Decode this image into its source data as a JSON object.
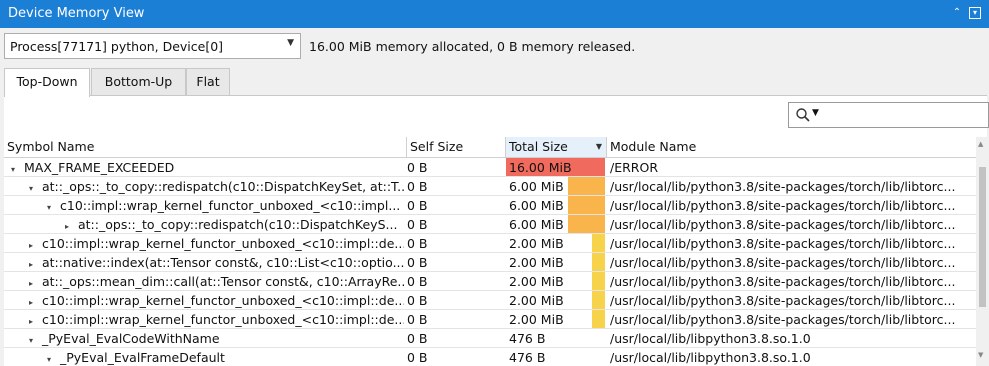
{
  "window": {
    "title": "Device Memory View"
  },
  "process_select": {
    "value": "Process[77171] python, Device[0]"
  },
  "summary": "16.00 MiB memory allocated, 0 B memory released.",
  "tabs": [
    {
      "label": "Top-Down",
      "active": true
    },
    {
      "label": "Bottom-Up",
      "active": false
    },
    {
      "label": "Flat",
      "active": false
    }
  ],
  "search": {
    "placeholder": ""
  },
  "columns": {
    "symbol": "Symbol Name",
    "self": "Self Size",
    "total": "Total Size",
    "module": "Module Name"
  },
  "rows": [
    {
      "symbol": "MAX_FRAME_EXCEEDED",
      "self": "0 B",
      "total": "16.00 MiB",
      "total_fraction": 1.0,
      "bar_color": "#f06a5e",
      "module": "/ERROR",
      "depth": 0,
      "expander": "expanded"
    },
    {
      "symbol": "at::_ops::_to_copy::redispatch(c10::DispatchKeySet, at::T...",
      "self": "0 B",
      "total": "6.00 MiB",
      "total_fraction": 0.375,
      "bar_color": "#f9b44c",
      "module": "/usr/local/lib/python3.8/site-packages/torch/lib/libtorc...",
      "depth": 1,
      "expander": "expanded"
    },
    {
      "symbol": "c10::impl::wrap_kernel_functor_unboxed_<c10::impl...",
      "self": "0 B",
      "total": "6.00 MiB",
      "total_fraction": 0.375,
      "bar_color": "#f9b44c",
      "module": "/usr/local/lib/python3.8/site-packages/torch/lib/libtorc...",
      "depth": 2,
      "expander": "expanded"
    },
    {
      "symbol": "at::_ops::_to_copy::redispatch(c10::DispatchKeyS...",
      "self": "0 B",
      "total": "6.00 MiB",
      "total_fraction": 0.375,
      "bar_color": "#f9b44c",
      "module": "/usr/local/lib/python3.8/site-packages/torch/lib/libtorc...",
      "depth": 3,
      "expander": "collapsed"
    },
    {
      "symbol": "c10::impl::wrap_kernel_functor_unboxed_<c10::impl::de...",
      "self": "0 B",
      "total": "2.00 MiB",
      "total_fraction": 0.125,
      "bar_color": "#f6d34a",
      "module": "/usr/local/lib/python3.8/site-packages/torch/lib/libtorc...",
      "depth": 1,
      "expander": "collapsed"
    },
    {
      "symbol": "at::native::index(at::Tensor const&, c10::List<c10::optio...",
      "self": "0 B",
      "total": "2.00 MiB",
      "total_fraction": 0.125,
      "bar_color": "#f6d34a",
      "module": "/usr/local/lib/python3.8/site-packages/torch/lib/libtorc...",
      "depth": 1,
      "expander": "collapsed"
    },
    {
      "symbol": "at::_ops::mean_dim::call(at::Tensor const&, c10::ArrayRe...",
      "self": "0 B",
      "total": "2.00 MiB",
      "total_fraction": 0.125,
      "bar_color": "#f6d34a",
      "module": "/usr/local/lib/python3.8/site-packages/torch/lib/libtorc...",
      "depth": 1,
      "expander": "collapsed"
    },
    {
      "symbol": "c10::impl::wrap_kernel_functor_unboxed_<c10::impl::de...",
      "self": "0 B",
      "total": "2.00 MiB",
      "total_fraction": 0.125,
      "bar_color": "#f6d34a",
      "module": "/usr/local/lib/python3.8/site-packages/torch/lib/libtorc...",
      "depth": 1,
      "expander": "collapsed"
    },
    {
      "symbol": "c10::impl::wrap_kernel_functor_unboxed_<c10::impl::de...",
      "self": "0 B",
      "total": "2.00 MiB",
      "total_fraction": 0.125,
      "bar_color": "#f6d34a",
      "module": "/usr/local/lib/python3.8/site-packages/torch/lib/libtorc...",
      "depth": 1,
      "expander": "collapsed"
    },
    {
      "symbol": "_PyEval_EvalCodeWithName",
      "self": "0 B",
      "total": "476 B",
      "total_fraction": 0.0,
      "bar_color": "#f6d34a",
      "module": "/usr/local/lib/libpython3.8.so.1.0",
      "depth": 1,
      "expander": "expanded"
    },
    {
      "symbol": "_PyEval_EvalFrameDefault",
      "self": "0 B",
      "total": "476 B",
      "total_fraction": 0.0,
      "bar_color": "#f6d34a",
      "module": "/usr/local/lib/libpython3.8.so.1.0",
      "depth": 2,
      "expander": "expanded"
    }
  ]
}
